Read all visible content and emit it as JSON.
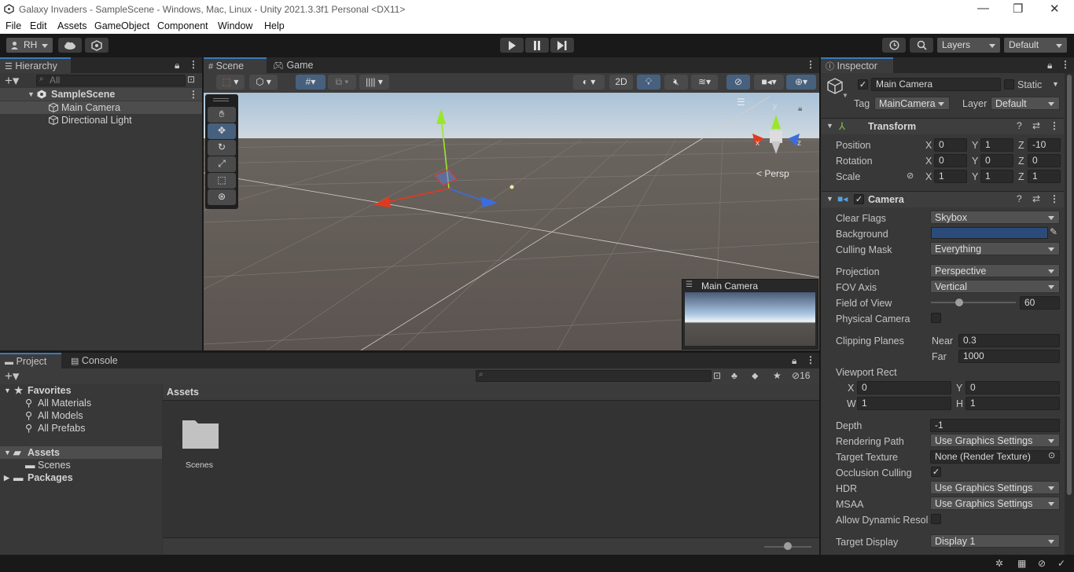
{
  "window": {
    "title": "Galaxy Invaders - SampleScene - Windows, Mac, Linux - Unity 2021.3.3f1 Personal <DX11>",
    "minimize": "—",
    "maximize": "❐",
    "close": "✕"
  },
  "menu": [
    "File",
    "Edit",
    "Assets",
    "GameObject",
    "Component",
    "Window",
    "Help"
  ],
  "toolbar": {
    "account": "RH",
    "layers": "Layers",
    "layout": "Default"
  },
  "hierarchy": {
    "tab": "Hierarchy",
    "search_placeholder": "All",
    "scene": "SampleScene",
    "items": [
      "Main Camera",
      "Directional Light"
    ]
  },
  "scene_view": {
    "tabs": [
      "Scene",
      "Game"
    ],
    "mode_2d": "2D",
    "persp_label": "< Persp",
    "gizmo_y": "y",
    "gizmo_x": "x",
    "gizmo_z": "z",
    "camera_preview_title": "Main Camera"
  },
  "project": {
    "tabs": [
      "Project",
      "Console"
    ],
    "hidden_count": "16",
    "favorites_label": "Favorites",
    "favorites": [
      "All Materials",
      "All Models",
      "All Prefabs"
    ],
    "assets_label": "Assets",
    "assets_children": [
      "Scenes"
    ],
    "packages_label": "Packages",
    "breadcrumb": "Assets",
    "grid_items": [
      "Scenes"
    ]
  },
  "inspector": {
    "tab": "Inspector",
    "object_name": "Main Camera",
    "static_label": "Static",
    "tag_label": "Tag",
    "tag_value": "MainCamera",
    "layer_label": "Layer",
    "layer_value": "Default",
    "transform": {
      "title": "Transform",
      "rows": [
        {
          "label": "Position",
          "x": "0",
          "y": "1",
          "z": "-10"
        },
        {
          "label": "Rotation",
          "x": "0",
          "y": "0",
          "z": "0"
        },
        {
          "label": "Scale",
          "x": "1",
          "y": "1",
          "z": "1"
        }
      ]
    },
    "camera": {
      "title": "Camera",
      "clear_flags_label": "Clear Flags",
      "clear_flags": "Skybox",
      "background_label": "Background",
      "background_color": "#2b4b7b",
      "culling_mask_label": "Culling Mask",
      "culling_mask": "Everything",
      "projection_label": "Projection",
      "projection": "Perspective",
      "fov_axis_label": "FOV Axis",
      "fov_axis": "Vertical",
      "fov_label": "Field of View",
      "fov": "60",
      "fov_fraction": 0.33,
      "physical_label": "Physical Camera",
      "clipping_label": "Clipping Planes",
      "near_label": "Near",
      "near": "0.3",
      "far_label": "Far",
      "far": "1000",
      "viewport_label": "Viewport Rect",
      "vx": "0",
      "vy": "0",
      "vw": "1",
      "vh": "1",
      "depth_label": "Depth",
      "depth": "-1",
      "rendering_path_label": "Rendering Path",
      "rendering_path": "Use Graphics Settings",
      "target_texture_label": "Target Texture",
      "target_texture": "None (Render Texture)",
      "occlusion_label": "Occlusion Culling",
      "hdr_label": "HDR",
      "hdr": "Use Graphics Settings",
      "msaa_label": "MSAA",
      "msaa": "Use Graphics Settings",
      "dynamic_label": "Allow Dynamic Resol",
      "target_display_label": "Target Display",
      "target_display": "Display 1"
    }
  }
}
